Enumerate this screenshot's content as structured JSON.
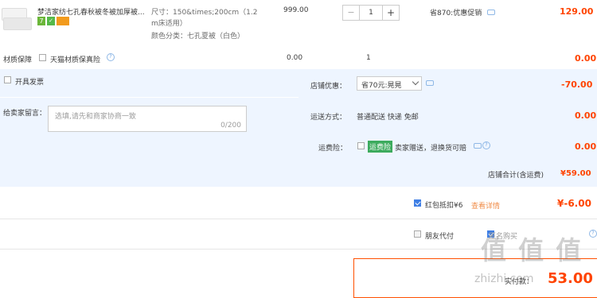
{
  "item": {
    "title": "梦洁家纺七孔春秋被冬被加厚被...",
    "spec_line1": "尺寸：150&times;200cm（1.2",
    "spec_line2": "m床适用）",
    "spec_line3": "颜色分类：七孔夏被（白色）",
    "price": "999.00",
    "quantity": "1",
    "minus": "−",
    "plus": "+",
    "promo": "省870:优惠促销",
    "subtotal": "129.00",
    "badge_7": "7",
    "badge_green": "✓"
  },
  "insurance": {
    "label": "材质保障",
    "option": "天猫材质保真险",
    "price": "0.00",
    "qty": "1",
    "subtotal": "0.00"
  },
  "invoice": {
    "label": "开具发票"
  },
  "discount": {
    "label": "店铺优惠：",
    "select_value": "省70元:晃晃",
    "amount": "-70.00"
  },
  "message": {
    "label": "给卖家留言：",
    "placeholder": "选填,请先和商家协商一致",
    "counter": "0/200"
  },
  "shipping": {
    "label": "运送方式：",
    "value": "普通配送 快递 免邮",
    "amount": "0.00"
  },
  "freight_insurance": {
    "label": "运费险：",
    "tag": "运费险",
    "desc": "卖家赠送，退换货可赔",
    "amount": "0.00"
  },
  "shop_total": {
    "label": "店铺合计(含运费)",
    "amount": "¥59.00"
  },
  "red_packet": {
    "label": "红包抵扣¥6",
    "link": "查看详情",
    "amount": "¥-6.00"
  },
  "friend_pay": {
    "label": "朋友代付",
    "anon_label": "匿名购买"
  },
  "footer": {
    "label": "实付款：",
    "amount": "53.00"
  },
  "watermark": {
    "text": "zhizhi.com",
    "logo": "值 值 值"
  },
  "colors": {
    "accent_red": "#ff4400",
    "link_blue": "#3388ff",
    "section_bg": "#eef5ff"
  }
}
